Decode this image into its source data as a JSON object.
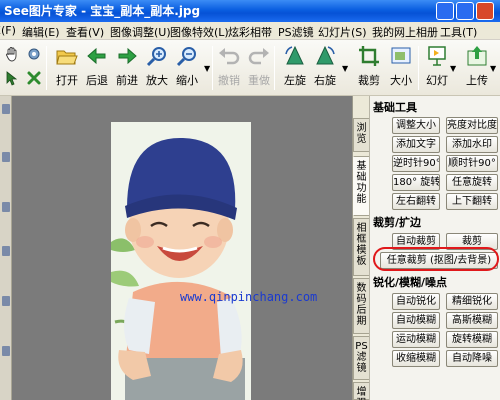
{
  "window": {
    "title": "See图片专家 - 宝宝_副本_副本.jpg"
  },
  "menu": [
    "E(F)",
    "编辑(E)",
    "查看(V)",
    "图像调整(U)",
    "图像特效(L)",
    "炫彩相带",
    "PS滤镜",
    "幻灯片(S)",
    "我的网上相册",
    "工具(T)"
  ],
  "toolbar": [
    {
      "label": "打开",
      "icon": "open-folder-icon",
      "enabled": true
    },
    {
      "label": "后退",
      "icon": "back-arrow-icon",
      "enabled": true
    },
    {
      "label": "前进",
      "icon": "forward-arrow-icon",
      "enabled": true
    },
    {
      "label": "放大",
      "icon": "zoom-in-icon",
      "enabled": true
    },
    {
      "label": "缩小",
      "icon": "zoom-out-icon",
      "enabled": true
    },
    {
      "label": "撤销",
      "icon": "undo-icon",
      "enabled": false
    },
    {
      "label": "重做",
      "icon": "redo-icon",
      "enabled": false
    },
    {
      "label": "左旋",
      "icon": "rotate-left-icon",
      "enabled": true
    },
    {
      "label": "右旋",
      "icon": "rotate-right-icon",
      "enabled": true
    },
    {
      "label": "裁剪",
      "icon": "crop-icon",
      "enabled": true
    },
    {
      "label": "大小",
      "icon": "resize-icon",
      "enabled": true
    },
    {
      "label": "幻灯",
      "icon": "slideshow-icon",
      "enabled": true
    },
    {
      "label": "上传",
      "icon": "upload-icon",
      "enabled": true
    }
  ],
  "canvas": {
    "watermark": "www.qinpinchang.com"
  },
  "side_tabs": [
    "浏览",
    "基础功能",
    "相框模板",
    "数码后期",
    "PS滤镜",
    "增强"
  ],
  "panel": {
    "sections": [
      {
        "title": "基础工具",
        "buttons": [
          "调整大小",
          "亮度对比度",
          "添加文字",
          "添加水印",
          "逆时针90°",
          "顺时针90°",
          "180° 旋转",
          "任意旋转",
          "左右翻转",
          "上下翻转"
        ]
      },
      {
        "title": "裁剪/扩边",
        "buttons": [
          "自动裁剪",
          "裁剪",
          "任意裁剪 (抠图/去背景)"
        ]
      },
      {
        "title": "锐化/模糊/噪点",
        "buttons": [
          "自动锐化",
          "精细锐化",
          "自动模糊",
          "高斯模糊",
          "运动模糊",
          "旋转模糊",
          "收缩模糊",
          "自动降噪"
        ]
      }
    ]
  },
  "colors": {
    "highlight": "#e0181b",
    "titlebar": "#0a5ee0",
    "watermark": "#1a3ad0"
  }
}
